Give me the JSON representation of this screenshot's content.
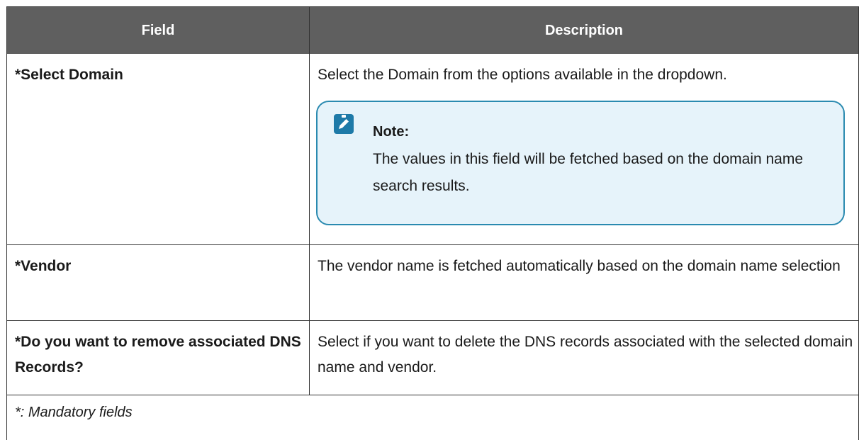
{
  "table": {
    "header": {
      "field": "Field",
      "description": "Description"
    },
    "rows": [
      {
        "field": "*Select Domain",
        "description": "Select the Domain from the options available in the dropdown.",
        "note": {
          "title": "Note:",
          "text": "The values in this field will be fetched based on the domain name search results."
        }
      },
      {
        "field": "*Vendor",
        "description": "The vendor name is fetched automatically based on the domain name selection"
      },
      {
        "field": "*Do you want to remove associated DNS Records?",
        "description": "Select if you want to delete the DNS records associated with the selected domain name and vendor."
      }
    ],
    "footnote": "*: Mandatory fields"
  },
  "colors": {
    "header_bg": "#5f5f5f",
    "note_border": "#2a8ab0",
    "note_bg": "#e6f3fa",
    "note_icon": "#1e7aa8"
  },
  "icons": {
    "note": "pencil-clipboard-icon"
  }
}
